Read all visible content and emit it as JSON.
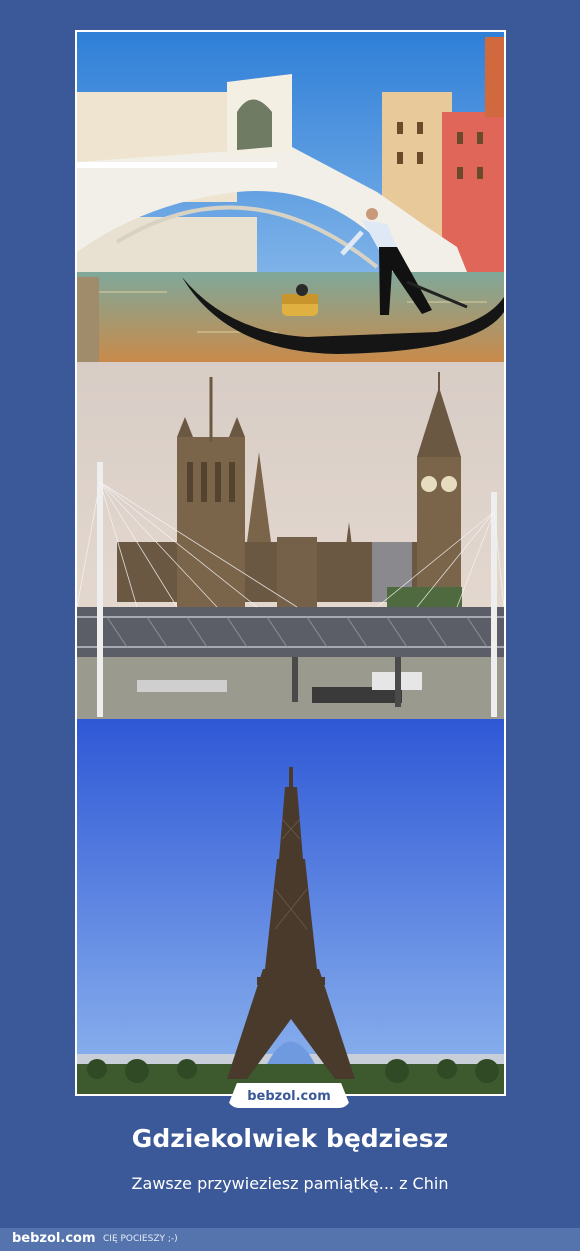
{
  "panels": [
    {
      "scene": "venice-rialto-gondola"
    },
    {
      "scene": "london-big-ben-parliament"
    },
    {
      "scene": "paris-eiffel-tower"
    }
  ],
  "badge": {
    "label": "bebzol.com"
  },
  "caption": {
    "title": "Gdziekolwiek będziesz",
    "subtitle": "Zawsze przywieziesz pamiątkę... z Chin"
  },
  "footer": {
    "logo": "bebzol.com",
    "tagline": "CIĘ POCIESZY ;-)"
  },
  "colors": {
    "background": "#3b5998",
    "footer_bar": "#5574ae",
    "text": "#ffffff"
  }
}
